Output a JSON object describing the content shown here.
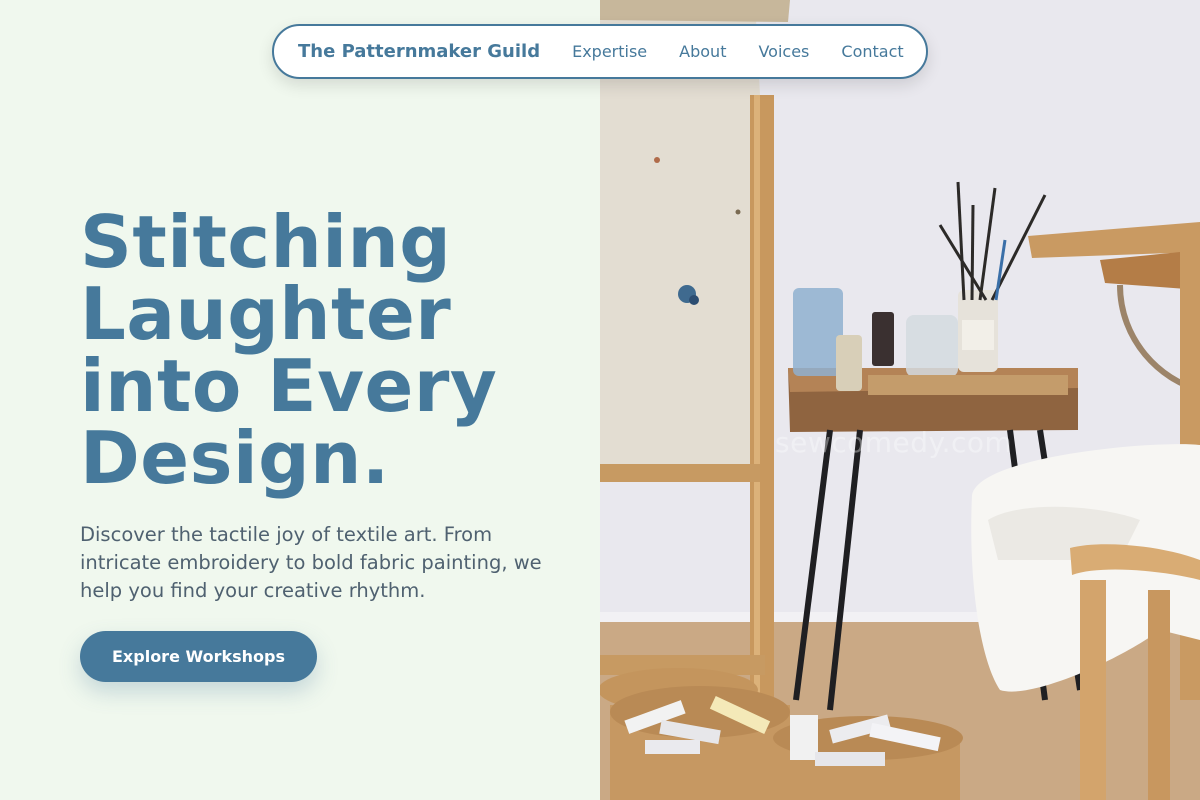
{
  "nav": {
    "brand": "The Patternmaker Guild",
    "links": [
      "Expertise",
      "About",
      "Voices",
      "Contact"
    ]
  },
  "hero": {
    "headline_lines": [
      "Stitching",
      "Laughter",
      "into Every",
      "Design."
    ],
    "intro": "Discover the tactile joy of textile art. From intricate embroidery to bold fabric painting, we help you find your creative rhythm.",
    "cta_label": "Explore Workshops"
  },
  "photo": {
    "watermark": "sewcomedy.com"
  },
  "colors": {
    "accent": "#46799b",
    "background": "#f0f8ee",
    "body_text": "#4f6170"
  }
}
